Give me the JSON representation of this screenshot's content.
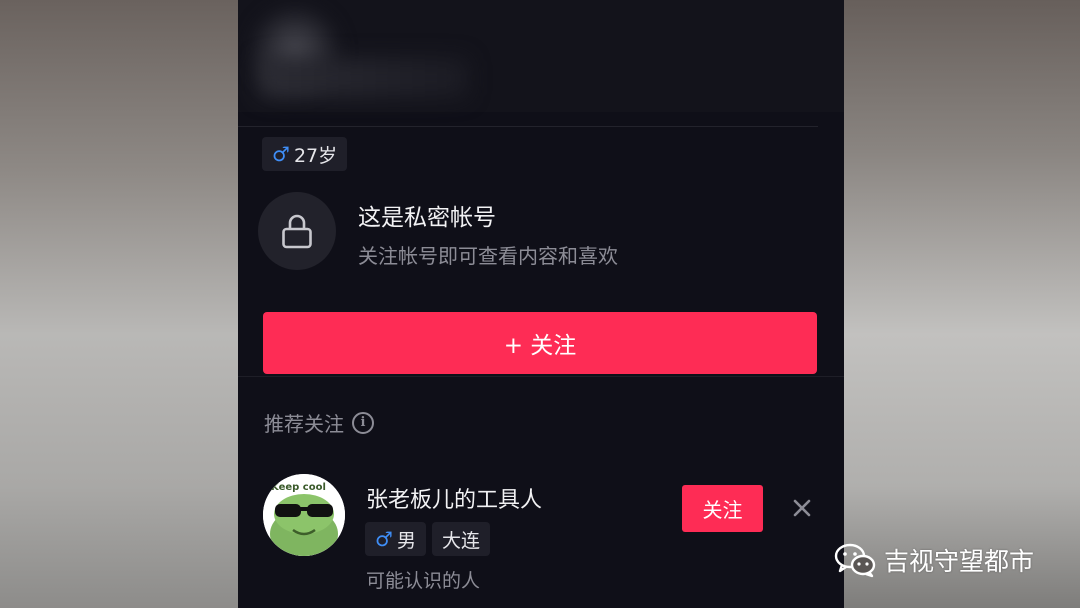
{
  "profile": {
    "age_tag": {
      "icon": "male-icon",
      "symbol": "♂",
      "text": "27岁"
    },
    "private_notice": {
      "icon": "lock-icon",
      "title": "这是私密帐号",
      "subtitle": "关注帐号即可查看内容和喜欢"
    },
    "follow_button": {
      "label": "+ 关注"
    }
  },
  "recommended": {
    "header": "推荐关注",
    "header_icon": "info-icon",
    "users": [
      {
        "name": "张老板儿的工具人",
        "avatar_text": "Keep cool",
        "gender_symbol": "♂",
        "gender": "男",
        "city": "大连",
        "reason": "可能认识的人",
        "follow_label": "关注",
        "dismiss_icon": "close-icon"
      }
    ]
  },
  "watermark": {
    "icon": "wechat-icon",
    "text": "吉视守望都市"
  },
  "colors": {
    "accent": "#fe2c55",
    "background": "#0f0f18",
    "male_blue": "#3f8ef7",
    "tag_bg": "#1f1f29"
  }
}
